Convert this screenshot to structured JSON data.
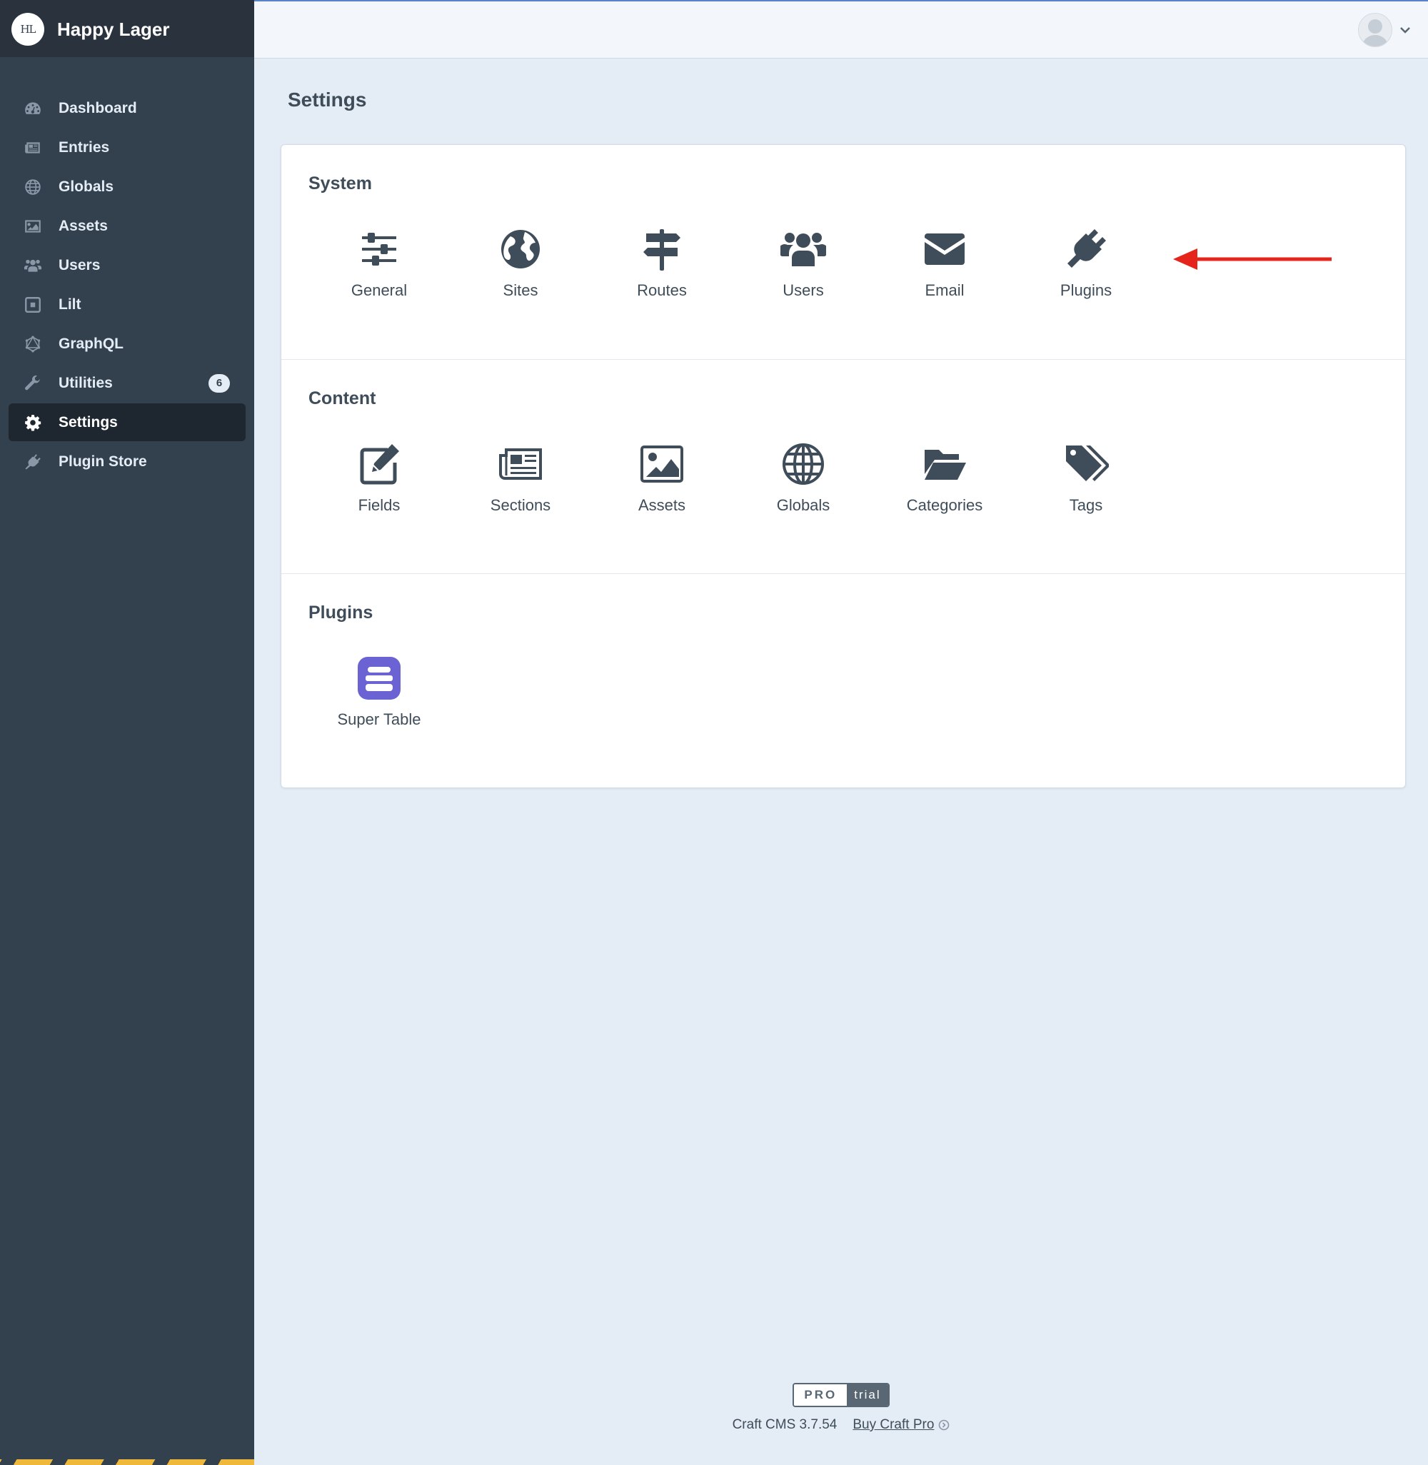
{
  "site": {
    "logo_text": "HL",
    "name": "Happy Lager"
  },
  "sidebar": {
    "items": [
      {
        "label": "Dashboard",
        "icon": "gauge-icon"
      },
      {
        "label": "Entries",
        "icon": "newspaper-icon"
      },
      {
        "label": "Globals",
        "icon": "globe-icon"
      },
      {
        "label": "Assets",
        "icon": "image-icon"
      },
      {
        "label": "Users",
        "icon": "users-icon"
      },
      {
        "label": "Lilt",
        "icon": "lilt-icon"
      },
      {
        "label": "GraphQL",
        "icon": "graphql-icon"
      },
      {
        "label": "Utilities",
        "icon": "wrench-icon",
        "badge": "6"
      },
      {
        "label": "Settings",
        "icon": "gear-icon",
        "active": true
      },
      {
        "label": "Plugin Store",
        "icon": "plug-icon"
      }
    ]
  },
  "page": {
    "title": "Settings"
  },
  "sections": [
    {
      "title": "System",
      "items": [
        {
          "label": "General",
          "icon": "sliders-icon"
        },
        {
          "label": "Sites",
          "icon": "globe-icon"
        },
        {
          "label": "Routes",
          "icon": "signpost-icon"
        },
        {
          "label": "Users",
          "icon": "users-icon"
        },
        {
          "label": "Email",
          "icon": "envelope-icon"
        },
        {
          "label": "Plugins",
          "icon": "plug-icon"
        }
      ]
    },
    {
      "title": "Content",
      "items": [
        {
          "label": "Fields",
          "icon": "edit-icon"
        },
        {
          "label": "Sections",
          "icon": "newspaper-icon"
        },
        {
          "label": "Assets",
          "icon": "image-icon"
        },
        {
          "label": "Globals",
          "icon": "globe-grid-icon"
        },
        {
          "label": "Categories",
          "icon": "folder-open-icon"
        },
        {
          "label": "Tags",
          "icon": "tags-icon"
        }
      ]
    },
    {
      "title": "Plugins",
      "items": [
        {
          "label": "Super Table",
          "icon": "super-table-icon"
        }
      ]
    }
  ],
  "footer": {
    "edition": "PRO",
    "trial": "trial",
    "version": "Craft CMS 3.7.54",
    "buy_label": "Buy Craft Pro"
  },
  "colors": {
    "sidebar_bg": "#33404d",
    "page_bg": "#e4edf6",
    "icon": "#3f4d5a",
    "annotation_arrow": "#e5241c",
    "super_table": "#6b63d4"
  }
}
